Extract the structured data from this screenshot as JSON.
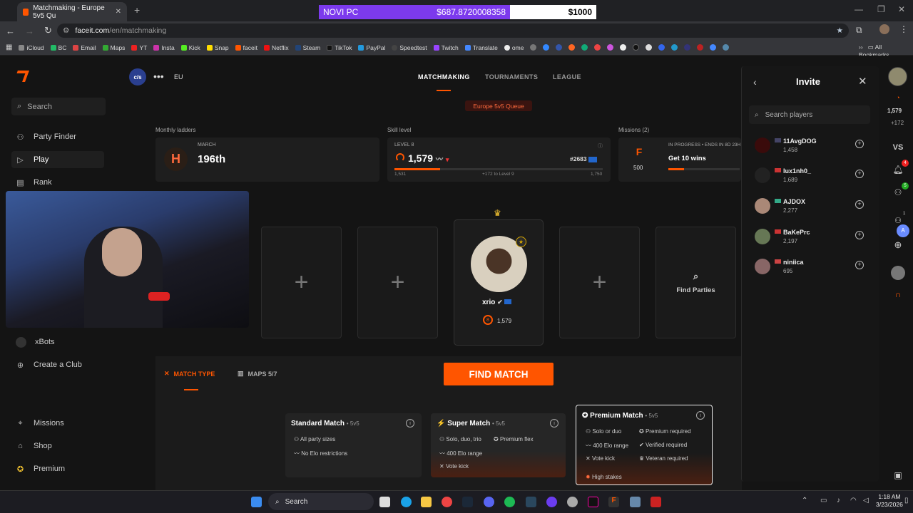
{
  "browser": {
    "tab_title": "Matchmaking - Europe 5v5 Qu",
    "new_tab_icon": "plus-icon",
    "url_host": "faceit.com",
    "url_path": "/en/matchmaking",
    "bookmarks": [
      "iCloud",
      "BC",
      "Email",
      "Maps",
      "YT",
      "Insta",
      "Kick",
      "Snap",
      "faceit",
      "Netflix",
      "Steam",
      "TikTok",
      "PayPal",
      "Speedtest",
      "Twitch",
      "Translate",
      "ome"
    ],
    "all_bookmarks": "All Bookmarks"
  },
  "stream_overlay": {
    "label": "NOVI PC",
    "amount": "$687.8720008358",
    "goal": "$1000"
  },
  "sidebar": {
    "search": "Search",
    "items": [
      {
        "label": "Party Finder",
        "icon": "users-icon"
      },
      {
        "label": "Play",
        "icon": "play-icon"
      },
      {
        "label": "Rank",
        "icon": "rank-icon"
      },
      {
        "label": "xBots",
        "icon": "club-icon"
      },
      {
        "label": "Create a Club",
        "icon": "plus-circle-icon"
      },
      {
        "label": "Missions",
        "icon": "target-icon"
      },
      {
        "label": "Shop",
        "icon": "bag-icon"
      },
      {
        "label": "Premium",
        "icon": "star-icon"
      }
    ]
  },
  "header": {
    "org": "c/s",
    "region": "EU",
    "tabs": [
      "MATCHMAKING",
      "TOURNAMENTS",
      "LEAGUE"
    ],
    "queue": "Europe 5v5 Queue"
  },
  "stats": {
    "ladder_label": "Monthly ladders",
    "ladder_month": "MARCH",
    "ladder_rank": "196th",
    "skill_label": "Skill level",
    "skill_level": "LEVEL 8",
    "skill_elo": "1,579",
    "skill_rank": "#2683",
    "skill_min": "1,531",
    "skill_next": "+172 to Level 9",
    "skill_max": "1,750",
    "skill_progress": 0.22,
    "missions_label": "Missions (2)",
    "mission_status": "IN PROGRESS • ENDS IN 8D 23H",
    "mission_title": "Get 10 wins",
    "mission_icon": "F",
    "mission_points": "500",
    "mission_progress": 0.22
  },
  "party": {
    "player_name": "xrio",
    "player_level": "8",
    "player_elo": "1,579",
    "find_parties": "Find Parties"
  },
  "match": {
    "type_tab": "MATCH TYPE",
    "maps_tab": "MAPS 5/7",
    "find_button": "FIND MATCH",
    "cards": [
      {
        "title": "Standard Match",
        "mode": "• 5v5",
        "features": [
          "All party sizes",
          "No Elo restrictions"
        ]
      },
      {
        "title": "Super Match",
        "mode": "• 5v5",
        "features": [
          "Solo, duo, trio",
          "Premium flex",
          "400 Elo range",
          "Vote kick"
        ]
      },
      {
        "title": "Premium Match",
        "mode": "• 5v5",
        "features": [
          "Solo or duo",
          "Premium required",
          "400 Elo range",
          "Verified required",
          "Vote kick",
          "Veteran required",
          "High stakes"
        ]
      }
    ]
  },
  "invite": {
    "title": "Invite",
    "search_placeholder": "Search players",
    "players": [
      {
        "name": "11AvgDOG",
        "elo": "1,458"
      },
      {
        "name": "lux1nh0_",
        "elo": "1,689"
      },
      {
        "name": "AJDOX",
        "elo": "2,277"
      },
      {
        "name": "BaKePrc",
        "elo": "2,197"
      },
      {
        "name": "niniica",
        "elo": "695"
      }
    ]
  },
  "rail": {
    "elo": "1,579",
    "plus": "+172",
    "vs": "VS",
    "notif_count": "4",
    "friends_count": "5",
    "party_count": "1"
  },
  "taskbar": {
    "search": "Search",
    "time": "1:18 AM",
    "date": "3/23/2026"
  }
}
